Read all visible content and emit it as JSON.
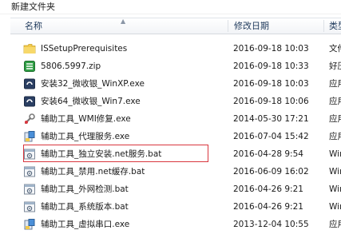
{
  "window": {
    "folder_name": "新建文件夹"
  },
  "columns": {
    "name": "名称",
    "date": "修改日期",
    "type": "类型"
  },
  "files": [
    {
      "name": "ISSetupPrerequisites",
      "date": "2016-09-18 10:03",
      "type": "文件",
      "icon": "folder-icon"
    },
    {
      "name": "5806.5997.zip",
      "date": "2016-09-18 10:33",
      "type": "好压",
      "icon": "zip-archive-icon"
    },
    {
      "name": "安装32_微收银_WinXP.exe",
      "date": "2016-09-18 10:03",
      "type": "应用",
      "icon": "installer-exe-icon"
    },
    {
      "name": "安装64_微收银_Win7.exe",
      "date": "2016-09-18 10:06",
      "type": "应用",
      "icon": "installer-exe-icon"
    },
    {
      "name": "辅助工具_WMI修复.exe",
      "date": "2014-05-30 17:21",
      "type": "应用",
      "icon": "wrench-exe-icon"
    },
    {
      "name": "辅助工具_代理服务.exe",
      "date": "2016-07-04 15:42",
      "type": "应用",
      "icon": "setup-exe-icon"
    },
    {
      "name": "辅助工具_独立安装.net服务.bat",
      "date": "2016-04-28 9:54",
      "type": "Win",
      "icon": "batch-file-icon"
    },
    {
      "name": "辅助工具_禁用.net缓存.bat",
      "date": "2016-06-09 16:02",
      "type": "Win",
      "icon": "batch-file-icon"
    },
    {
      "name": "辅助工具_外网检测.bat",
      "date": "2016-04-26 9:21",
      "type": "Win",
      "icon": "batch-file-icon"
    },
    {
      "name": "辅助工具_系统版本.bat",
      "date": "2016-04-26 9:21",
      "type": "Win",
      "icon": "batch-file-icon"
    },
    {
      "name": "辅助工具_虚拟串口.exe",
      "date": "2013-12-04 10:55",
      "type": "应用",
      "icon": "setup-exe-icon"
    }
  ]
}
